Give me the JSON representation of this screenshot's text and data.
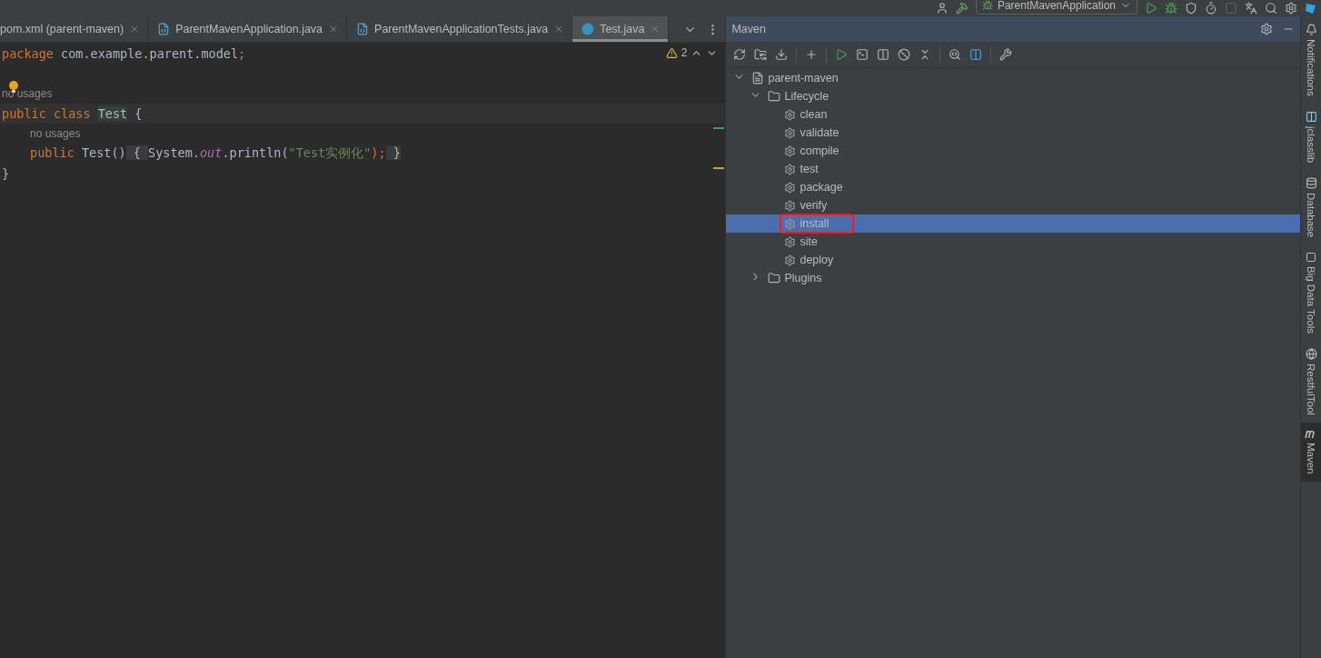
{
  "toolbar": {
    "run_config": "ParentMavenApplication"
  },
  "tabs": [
    {
      "label": "pom.xml (parent-maven)",
      "kind": "xml",
      "selected": false
    },
    {
      "label": "ParentMavenApplication.java",
      "kind": "java",
      "selected": false
    },
    {
      "label": "ParentMavenApplicationTests.java",
      "kind": "java",
      "selected": false
    },
    {
      "label": "Test.java",
      "kind": "class",
      "selected": true
    }
  ],
  "editor": {
    "warning_count": "2",
    "lines": [
      {
        "kind": "code",
        "indent": false,
        "current": false,
        "tokens": [
          {
            "text": "package",
            "kind": "keyword"
          },
          {
            "text": " com.example.parent.model",
            "kind": "plain"
          },
          {
            "text": ";",
            "kind": "keyword"
          }
        ]
      },
      {
        "kind": "blank"
      },
      {
        "kind": "hint",
        "indent": false,
        "text": "no usages",
        "bulb": true
      },
      {
        "kind": "code",
        "indent": false,
        "current": true,
        "tokens": [
          {
            "text": "public class ",
            "kind": "keyword"
          },
          {
            "text": "Test",
            "kind": "decl"
          },
          {
            "text": " {",
            "kind": "plain"
          }
        ]
      },
      {
        "kind": "hint",
        "indent": true,
        "text": "no usages",
        "bulb": false
      },
      {
        "kind": "code",
        "indent": true,
        "current": false,
        "tokens": [
          {
            "text": "public ",
            "kind": "keyword"
          },
          {
            "text": "Test",
            "kind": "muted"
          },
          {
            "text": "()",
            "kind": "plain"
          },
          {
            "text": " { ",
            "kind": "fold"
          },
          {
            "text": "System.",
            "kind": "plain"
          },
          {
            "text": "out",
            "kind": "field"
          },
          {
            "text": ".println(",
            "kind": "plain"
          },
          {
            "text": "\"Test实例化\"",
            "kind": "string"
          },
          {
            "text": ");",
            "kind": "semi"
          },
          {
            "text": " }",
            "kind": "fold"
          }
        ]
      },
      {
        "kind": "code",
        "indent": false,
        "current": false,
        "tokens": [
          {
            "text": "}",
            "kind": "plain"
          }
        ]
      }
    ]
  },
  "maven": {
    "title": "Maven",
    "tree": [
      {
        "label": "parent-maven",
        "kind": "project",
        "expanded": true,
        "selected": false,
        "children": [
          {
            "label": "Lifecycle",
            "kind": "folder",
            "expanded": true,
            "selected": false,
            "children": [
              {
                "label": "clean",
                "kind": "goal",
                "selected": false
              },
              {
                "label": "validate",
                "kind": "goal",
                "selected": false
              },
              {
                "label": "compile",
                "kind": "goal",
                "selected": false
              },
              {
                "label": "test",
                "kind": "goal",
                "selected": false
              },
              {
                "label": "package",
                "kind": "goal",
                "selected": false
              },
              {
                "label": "verify",
                "kind": "goal",
                "selected": false
              },
              {
                "label": "install",
                "kind": "goal",
                "selected": true,
                "marked": true
              },
              {
                "label": "site",
                "kind": "goal",
                "selected": false
              },
              {
                "label": "deploy",
                "kind": "goal",
                "selected": false
              }
            ]
          },
          {
            "label": "Plugins",
            "kind": "folder",
            "expanded": false,
            "selected": false
          }
        ]
      }
    ]
  },
  "side_tools": [
    {
      "label": "Notifications",
      "kind": "bell",
      "selected": false
    },
    {
      "label": "jclasslib",
      "kind": "grid",
      "selected": false
    },
    {
      "label": "Database",
      "kind": "db",
      "selected": false
    },
    {
      "label": "Big Data Tools",
      "kind": "letter",
      "selected": false
    },
    {
      "label": "RestfulTool",
      "kind": "globe",
      "selected": false
    },
    {
      "label": "Maven",
      "kind": "maven",
      "selected": true
    }
  ]
}
